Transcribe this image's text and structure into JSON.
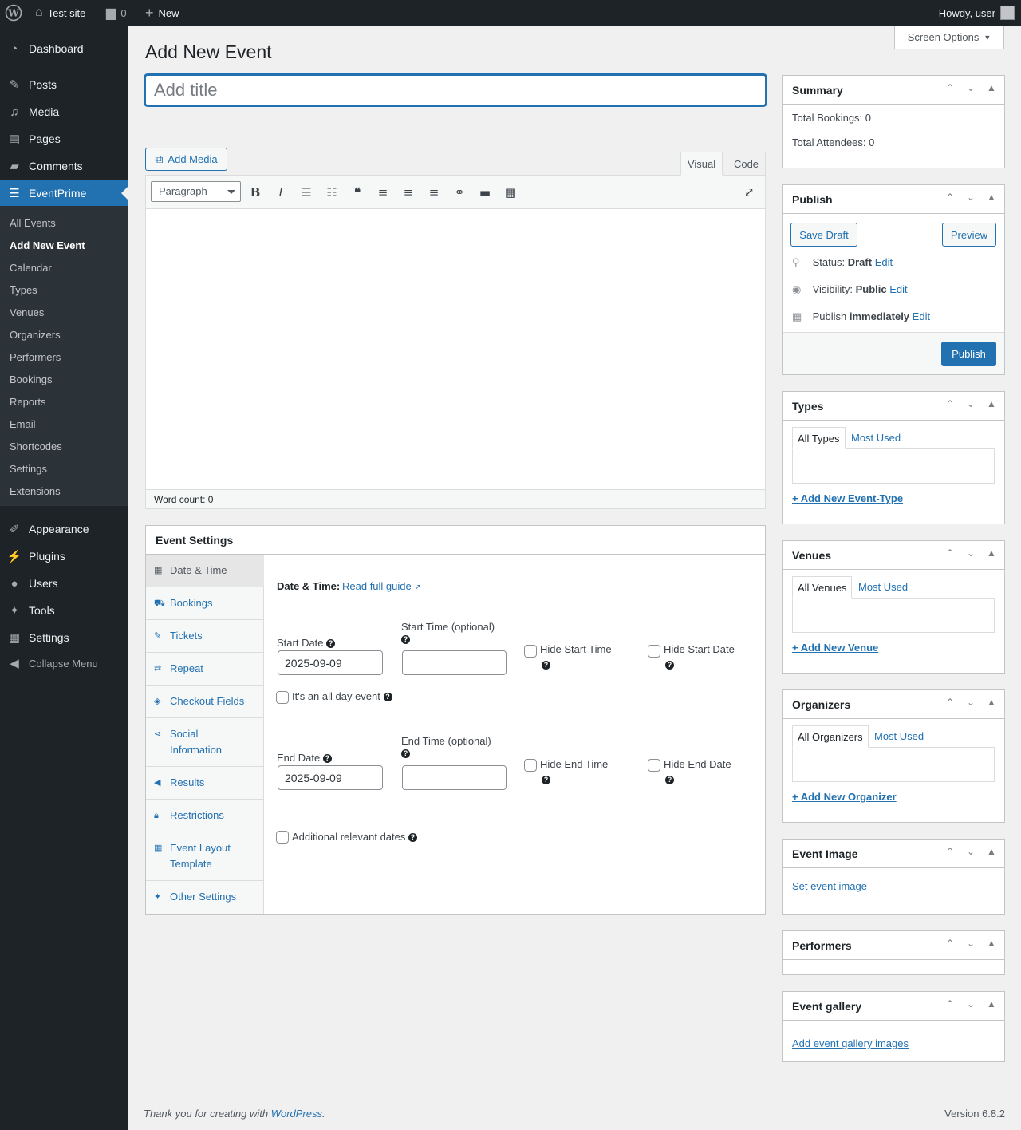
{
  "adminbar": {
    "wp_logo": "wordpress-icon",
    "site_name": "Test site",
    "comments_count": "0",
    "new_label": "New",
    "howdy": "Howdy, user"
  },
  "sidebar": {
    "items": [
      {
        "label": "Dashboard",
        "icon": "dashboard-icon"
      },
      {
        "label": "Posts",
        "icon": "pin-icon"
      },
      {
        "label": "Media",
        "icon": "media-icon"
      },
      {
        "label": "Pages",
        "icon": "page-icon"
      },
      {
        "label": "Comments",
        "icon": "comment-icon"
      },
      {
        "label": "EventPrime",
        "icon": "eventprime-icon"
      },
      {
        "label": "Appearance",
        "icon": "brush-icon"
      },
      {
        "label": "Plugins",
        "icon": "plug-icon"
      },
      {
        "label": "Users",
        "icon": "user-icon"
      },
      {
        "label": "Tools",
        "icon": "wrench-icon"
      },
      {
        "label": "Settings",
        "icon": "settings-icon"
      }
    ],
    "submenu": [
      "All Events",
      "Add New Event",
      "Calendar",
      "Types",
      "Venues",
      "Organizers",
      "Performers",
      "Bookings",
      "Reports",
      "Email",
      "Shortcodes",
      "Settings",
      "Extensions"
    ],
    "collapse": "Collapse Menu"
  },
  "page": {
    "title": "Add New Event",
    "screen_options": "Screen Options",
    "title_placeholder": "Add title"
  },
  "editor": {
    "add_media": "Add Media",
    "tab_visual": "Visual",
    "tab_code": "Code",
    "format": "Paragraph",
    "word_count": "Word count: 0"
  },
  "event_settings": {
    "heading": "Event Settings",
    "tabs": [
      "Date & Time",
      "Bookings",
      "Tickets",
      "Repeat",
      "Checkout Fields",
      "Social Information",
      "Results",
      "Restrictions",
      "Event Layout Template",
      "Other Settings"
    ],
    "section_label": "Date & Time:",
    "guide_link": "Read full guide",
    "start_date_label": "Start Date",
    "start_date_value": "2025-09-09",
    "start_time_label": "Start Time (optional)",
    "hide_start_time": "Hide Start Time",
    "hide_start_date": "Hide Start Date",
    "all_day": "It's an all day event",
    "end_date_label": "End Date",
    "end_date_value": "2025-09-09",
    "end_time_label": "End Time (optional)",
    "hide_end_time": "Hide End Time",
    "hide_end_date": "Hide End Date",
    "additional_dates": "Additional relevant dates"
  },
  "summary": {
    "heading": "Summary",
    "bookings": "Total Bookings: 0",
    "attendees": "Total Attendees: 0"
  },
  "publish": {
    "heading": "Publish",
    "save_draft": "Save Draft",
    "preview": "Preview",
    "status_label": "Status:",
    "status_value": "Draft",
    "visibility_label": "Visibility:",
    "visibility_value": "Public",
    "publish_label": "Publish",
    "publish_value": "immediately",
    "edit": "Edit",
    "publish_button": "Publish"
  },
  "types": {
    "heading": "Types",
    "tab_all": "All Types",
    "tab_most": "Most Used",
    "add": "+ Add New Event-Type"
  },
  "venues": {
    "heading": "Venues",
    "tab_all": "All Venues",
    "tab_most": "Most Used",
    "add": "+ Add New Venue"
  },
  "organizers": {
    "heading": "Organizers",
    "tab_all": "All Organizers",
    "tab_most": "Most Used",
    "add": "+ Add New Organizer"
  },
  "event_image": {
    "heading": "Event Image",
    "link": "Set event image"
  },
  "performers": {
    "heading": "Performers"
  },
  "gallery": {
    "heading": "Event gallery",
    "link": "Add event gallery images"
  },
  "footer": {
    "thanks": "Thank you for creating with ",
    "wp_link": "WordPress",
    "version": "Version 6.8.2"
  }
}
